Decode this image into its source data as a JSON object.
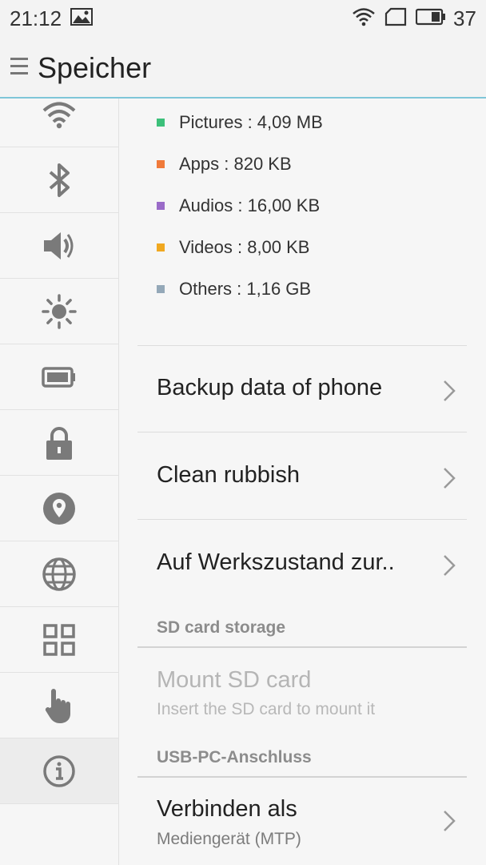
{
  "status_bar": {
    "time": "21:12",
    "battery": "37"
  },
  "header": {
    "title": "Speicher"
  },
  "sidebar": {
    "items": [
      {
        "icon": "wifi-icon"
      },
      {
        "icon": "bluetooth-icon"
      },
      {
        "icon": "volume-icon"
      },
      {
        "icon": "brightness-icon"
      },
      {
        "icon": "battery-icon"
      },
      {
        "icon": "lock-icon"
      },
      {
        "icon": "location-icon"
      },
      {
        "icon": "globe-icon"
      },
      {
        "icon": "apps-grid-icon"
      },
      {
        "icon": "hand-icon"
      },
      {
        "icon": "info-icon",
        "active": true
      }
    ]
  },
  "storage_legend": [
    {
      "label": "Pictures : 4,09 MB",
      "color": "#3cc07a"
    },
    {
      "label": "Apps : 820 KB",
      "color": "#f07a3a"
    },
    {
      "label": "Audios : 16,00 KB",
      "color": "#9a6bc8"
    },
    {
      "label": "Videos : 8,00 KB",
      "color": "#f0a820"
    },
    {
      "label": "Others : 1,16 GB",
      "color": "#94a8b8"
    }
  ],
  "menu": {
    "backup": "Backup data of phone",
    "clean": "Clean rubbish",
    "reset": "Auf Werkszustand zur.."
  },
  "sd_section": {
    "header": "SD card storage",
    "mount_title": "Mount SD card",
    "mount_subtitle": "Insert the SD card to mount it"
  },
  "usb_section": {
    "header": "USB-PC-Anschluss",
    "connect_title": "Verbinden als",
    "connect_subtitle": "Mediengerät (MTP)"
  }
}
